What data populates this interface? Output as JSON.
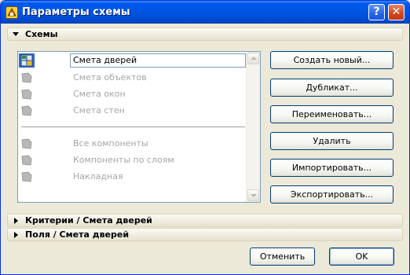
{
  "window": {
    "title": "Параметры схемы"
  },
  "titlebar": {
    "help_label": "?",
    "close_label": "✕"
  },
  "sections": {
    "schemes": "Схемы",
    "criteria": "Критерии /  Смета дверей",
    "fields": "Поля / Смета дверей"
  },
  "list": {
    "selected_value": "Смета дверей",
    "items": [
      "Смета объектов",
      "Смета окон",
      "Смета стен",
      "Все компоненты",
      "Компоненты по слоям",
      "Накладная"
    ]
  },
  "side_buttons": {
    "create": "Создать новый...",
    "duplicate": "Дубликат...",
    "rename": "Переименовать...",
    "delete": "Удалить",
    "import": "Импортировать...",
    "export": "Экспортировать..."
  },
  "footer": {
    "cancel": "Отменить",
    "ok": "OK"
  },
  "colors": {
    "titlebar": "#0054e3",
    "dialog_bg": "#ece9d8",
    "selection": "#316ac5",
    "disabled_text": "#a6a6a6"
  }
}
